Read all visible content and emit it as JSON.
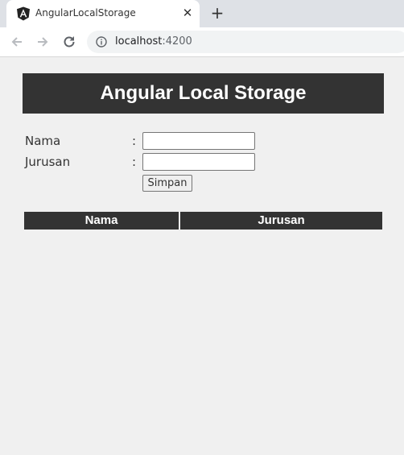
{
  "browser": {
    "tab_title": "AngularLocalStorage",
    "url_host": "localhost",
    "url_port": ":4200",
    "icons": [
      "angular-icon",
      "close-icon",
      "plus-icon",
      "back-arrow-icon",
      "forward-arrow-icon",
      "reload-icon",
      "info-icon"
    ]
  },
  "page": {
    "title": "Angular Local Storage",
    "form": {
      "nama_label": "Nama",
      "jurusan_label": "Jurusan",
      "separator": ":",
      "nama_value": "",
      "jurusan_value": "",
      "save_label": "Simpan"
    },
    "table": {
      "headers": [
        "Nama",
        "Jurusan"
      ],
      "rows": []
    }
  },
  "colors": {
    "header_bg": "#333333",
    "header_text": "#ffffff",
    "page_bg": "#f0f0f0"
  }
}
